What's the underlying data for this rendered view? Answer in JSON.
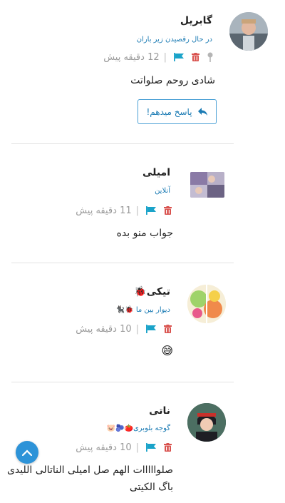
{
  "comments": [
    {
      "name": "گابریل",
      "status": "در حال رقصیدن زیر باران",
      "time": "12 دقیقه پیش",
      "text": "شادی روحم صلواتت",
      "reply_label": "پاسخ میدهم!",
      "icons": [
        "pin-icon",
        "trash-icon",
        "flag-icon"
      ]
    },
    {
      "name": "امیلی",
      "status": "آنلاین",
      "time": "11 دقیقه پیش",
      "text": "جواب منو بده",
      "icons": [
        "trash-icon",
        "flag-icon"
      ]
    },
    {
      "name": "تیکی",
      "name_emoji": "🐞",
      "status": "دیوار بین ما",
      "status_emoji": "🐞🐈‍⬛",
      "time": "10 دقیقه پیش",
      "text": "😅",
      "icons": [
        "trash-icon",
        "flag-icon"
      ]
    },
    {
      "name": "ناتی",
      "status": "گوجه بلوبری",
      "status_emoji": "🍅🫐🐷",
      "time": "10 دقیقه پیش",
      "text_line1": "صلوااااات الهم صل امیلی الناتالی الليدی",
      "text_line2": "باگ الکیتی",
      "icons": [
        "trash-icon",
        "flag-icon"
      ]
    }
  ],
  "colors": {
    "accent": "#1b7bb4",
    "trash": "#d9534f",
    "flag": "#1aa3c9",
    "fab": "#2d93d8"
  },
  "fab_icon": "chevron-up-icon"
}
